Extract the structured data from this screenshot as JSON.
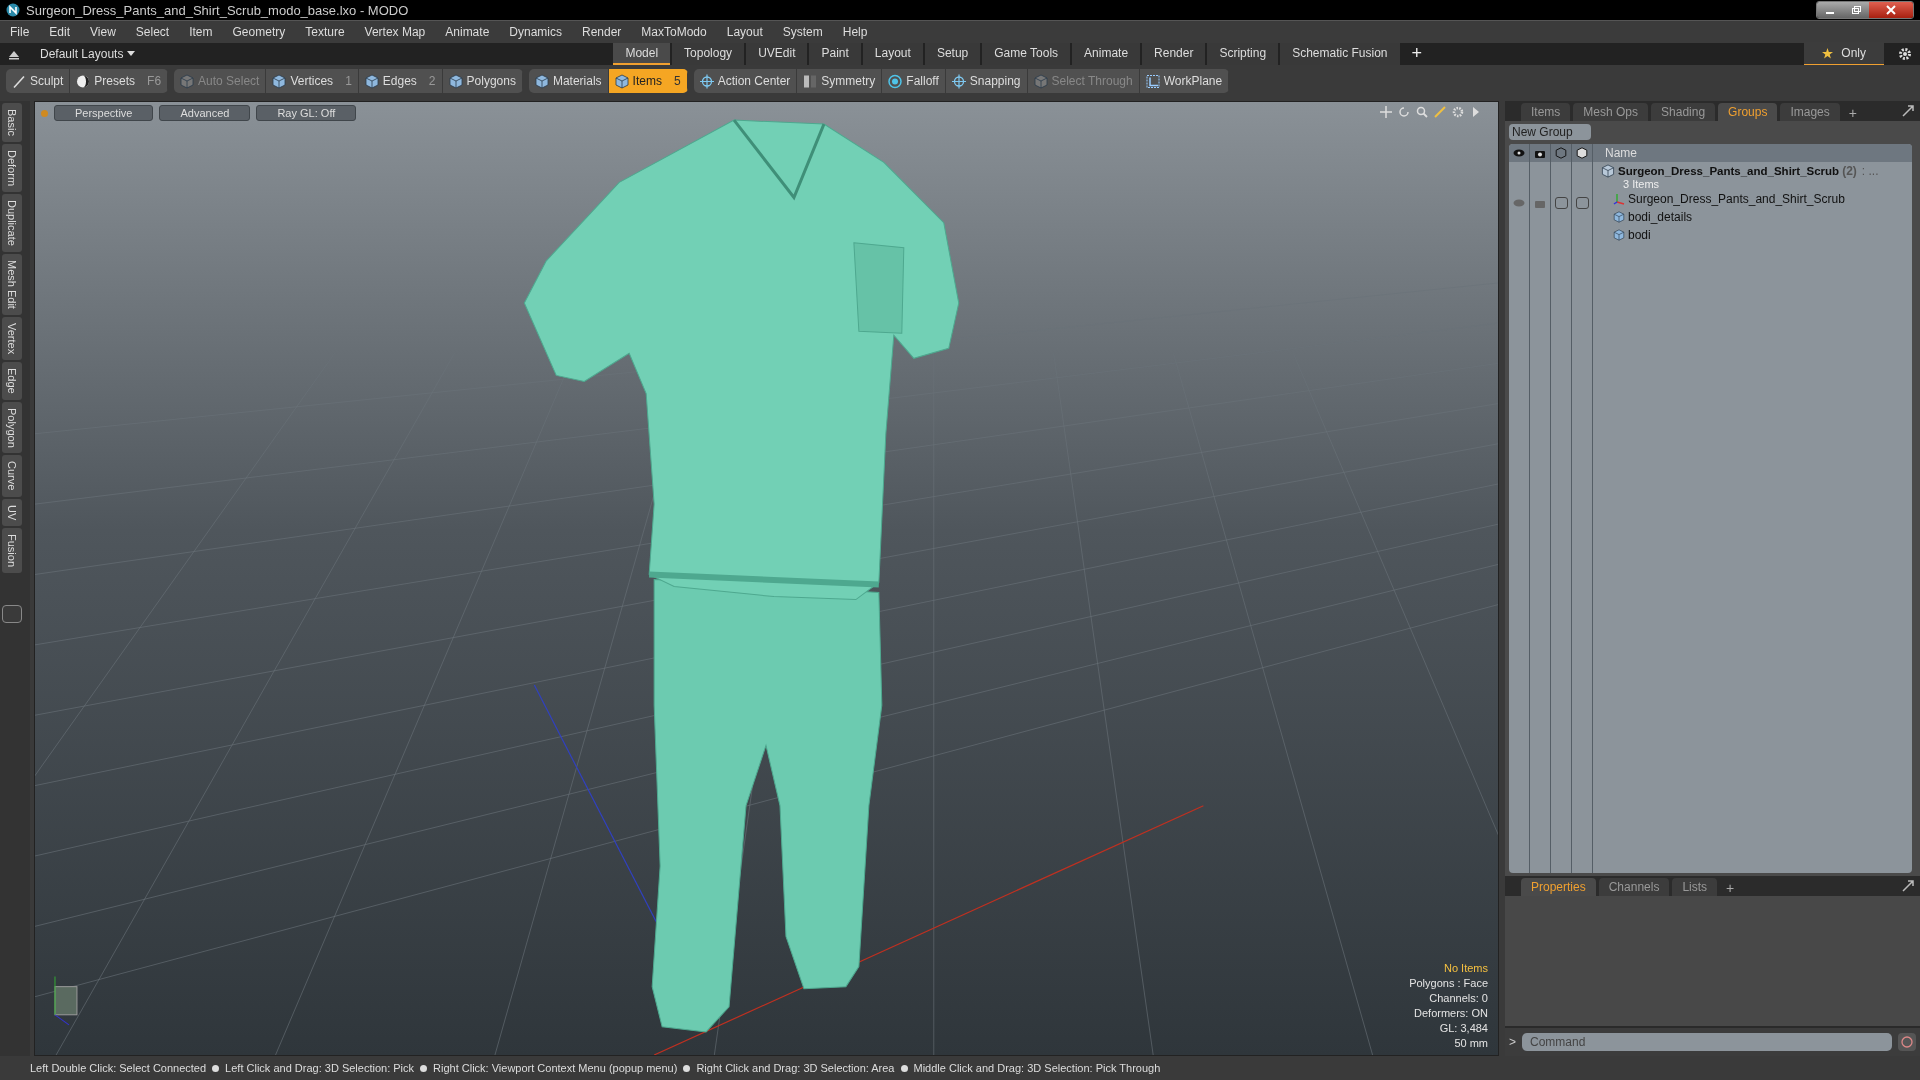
{
  "window": {
    "title": "Surgeon_Dress_Pants_and_Shirt_Scrub_modo_base.lxo - MODO"
  },
  "menu": [
    "File",
    "Edit",
    "View",
    "Select",
    "Item",
    "Geometry",
    "Texture",
    "Vertex Map",
    "Animate",
    "Dynamics",
    "Render",
    "MaxToModo",
    "Layout",
    "System",
    "Help"
  ],
  "layouts_dropdown": "Default Layouts",
  "layout_tabs": [
    {
      "label": "Model",
      "selected": true
    },
    {
      "label": "Topology",
      "selected": false
    },
    {
      "label": "UVEdit",
      "selected": false
    },
    {
      "label": "Paint",
      "selected": false
    },
    {
      "label": "Layout",
      "selected": false
    },
    {
      "label": "Setup",
      "selected": false
    },
    {
      "label": "Game Tools",
      "selected": false
    },
    {
      "label": "Animate",
      "selected": false
    },
    {
      "label": "Render",
      "selected": false
    },
    {
      "label": "Scripting",
      "selected": false
    },
    {
      "label": "Schematic Fusion",
      "selected": false
    }
  ],
  "add_tab": "+",
  "only_button": "Only",
  "toolbar": [
    [
      {
        "kind": "brush",
        "label": "Sculpt",
        "selected": false,
        "disabled": false
      },
      {
        "kind": "ball",
        "label": "Presets",
        "shortcut": "F6",
        "selected": false,
        "disabled": false
      }
    ],
    [
      {
        "kind": "cube",
        "label": "Auto Select",
        "selected": false,
        "disabled": true
      },
      {
        "kind": "cube",
        "label": "Vertices",
        "shortcut": "1",
        "selected": false,
        "disabled": false
      },
      {
        "kind": "cube",
        "label": "Edges",
        "shortcut": "2",
        "selected": false,
        "disabled": false
      },
      {
        "kind": "cube",
        "label": "Polygons",
        "selected": false,
        "disabled": false
      }
    ],
    [
      {
        "kind": "cube",
        "label": "Materials",
        "selected": false,
        "disabled": false
      },
      {
        "kind": "cube",
        "label": "Items",
        "shortcut": "5",
        "selected": true,
        "disabled": false
      }
    ],
    [
      {
        "kind": "crosshair",
        "label": "Action Center",
        "selected": false,
        "disabled": false
      },
      {
        "kind": "bar",
        "label": "Symmetry",
        "selected": false,
        "disabled": false
      },
      {
        "kind": "ring",
        "label": "Falloff",
        "selected": false,
        "disabled": false
      },
      {
        "kind": "crosshair",
        "label": "Snapping",
        "selected": false,
        "disabled": false
      },
      {
        "kind": "cube",
        "label": "Select Through",
        "selected": false,
        "disabled": true
      },
      {
        "kind": "grid",
        "label": "WorkPlane",
        "selected": false,
        "disabled": false
      }
    ]
  ],
  "side_tabs": [
    "Basic",
    "Deform",
    "Duplicate",
    "Mesh Edit",
    "Vertex",
    "Edge",
    "Polygon",
    "Curve",
    "UV",
    "Fusion"
  ],
  "viewport": {
    "buttons": [
      "Perspective",
      "Advanced",
      "Ray GL: Off"
    ],
    "info": [
      {
        "text": "No Items",
        "kind": "highlight"
      },
      {
        "text": "Polygons : Face",
        "kind": "plain"
      },
      {
        "text": "Channels: 0",
        "kind": "plain"
      },
      {
        "text": "Deformers: ON",
        "kind": "plain"
      },
      {
        "text": "GL: 3,484",
        "kind": "plain"
      },
      {
        "text": "50 mm",
        "kind": "plain"
      }
    ]
  },
  "groups_panel": {
    "tabs": [
      {
        "label": "Items",
        "selected": false
      },
      {
        "label": "Mesh Ops",
        "selected": false
      },
      {
        "label": "Shading",
        "selected": false
      },
      {
        "label": "Groups",
        "selected": true
      },
      {
        "label": "Images",
        "selected": false
      }
    ],
    "add_tab": "+",
    "new_group_button": "New Group",
    "name_column": "Name",
    "group": {
      "name": "Surgeon_Dress_Pants_and_Shirt_Scrub",
      "count": "(2)",
      "suffix": ": ...",
      "subtitle": "3 Items",
      "children": [
        {
          "name": "Surgeon_Dress_Pants_and_Shirt_Scrub",
          "kind": "locator"
        },
        {
          "name": "bodi_details",
          "kind": "mesh"
        },
        {
          "name": "bodi",
          "kind": "mesh"
        }
      ]
    }
  },
  "properties_panel": {
    "tabs": [
      {
        "label": "Properties",
        "selected": true
      },
      {
        "label": "Channels",
        "selected": false
      },
      {
        "label": "Lists",
        "selected": false
      }
    ],
    "add_tab": "+"
  },
  "command": {
    "prompt": ">",
    "placeholder": "Command"
  },
  "status_bar": [
    "Left Double Click: Select Connected",
    "Left Click and Drag: 3D Selection: Pick",
    "Right Click: Viewport Context Menu (popup menu)",
    "Right Click and Drag: 3D Selection: Area",
    "Middle Click and Drag: 3D Selection: Pick Through"
  ]
}
